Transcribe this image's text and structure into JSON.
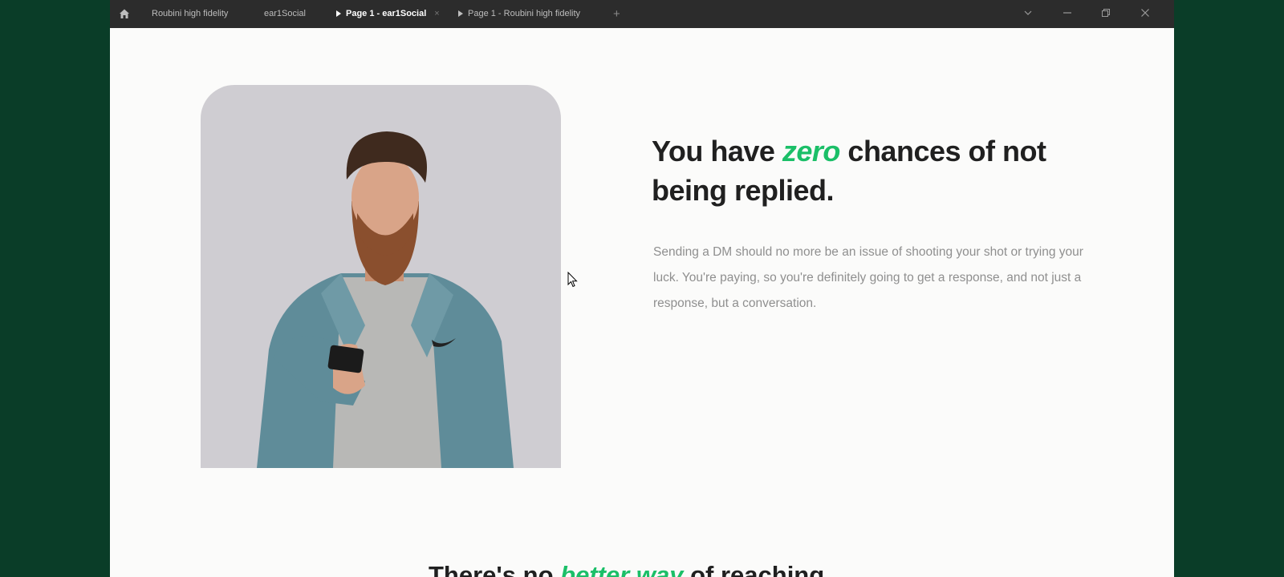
{
  "titlebar": {
    "tabs": [
      {
        "label": "Roubini high fidelity",
        "active": false,
        "play": false
      },
      {
        "label": "ear1Social",
        "active": false,
        "play": false
      },
      {
        "label": "Page 1 - ear1Social",
        "active": true,
        "play": true
      },
      {
        "label": "Page 1 - Roubini high fidelity",
        "active": false,
        "play": true
      }
    ],
    "add_tab": "+",
    "close_tab": "×"
  },
  "hero": {
    "headline_pre": "You have ",
    "headline_accent": "zero",
    "headline_post": " chances of not being replied.",
    "body": "Sending a DM should no more be an issue of shooting your shot or trying your luck. You're paying, so you're definitely going to get a response, and not just a response, but a conversation."
  },
  "next_section": {
    "heading_pre": "There's no ",
    "heading_accent": "better way",
    "heading_post": " of reaching"
  },
  "colors": {
    "accent": "#1bbf68",
    "outer_background": "#0a3d28",
    "titlebar": "#2c2c2c",
    "page_background": "#fbfbfa",
    "photo_background": "#cfcdd2"
  }
}
